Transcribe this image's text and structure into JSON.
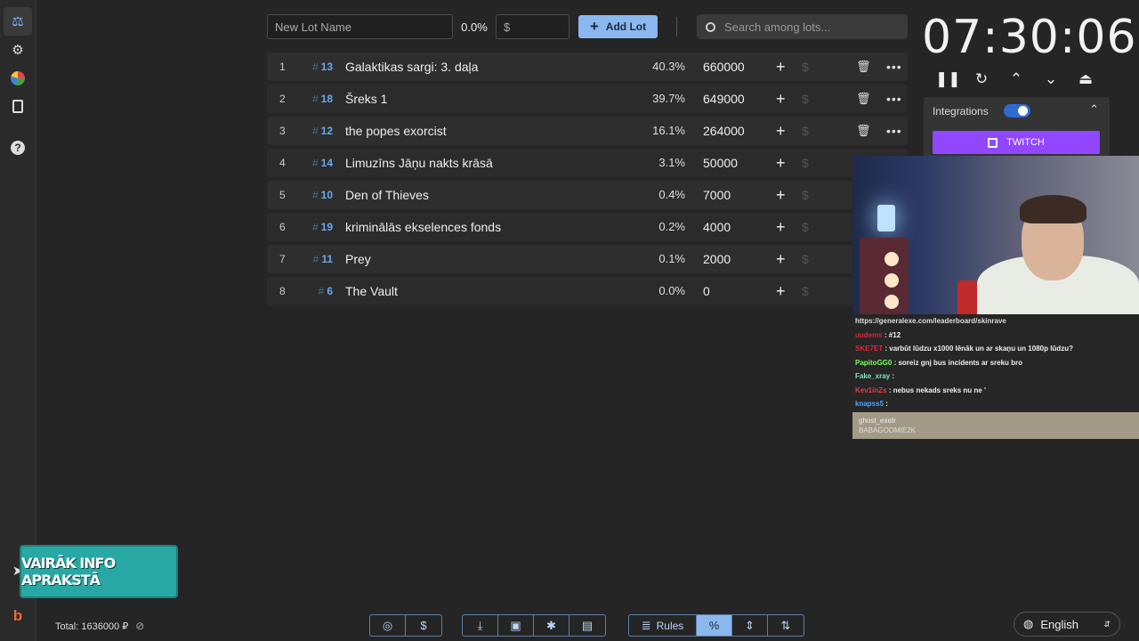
{
  "sidebar": {
    "items": [
      {
        "name": "auction-icon",
        "glyph": "⚖"
      },
      {
        "name": "settings-icon",
        "glyph": "⚙"
      },
      {
        "name": "wheel-icon",
        "glyph": "◕"
      },
      {
        "name": "clipboard-icon",
        "glyph": "📋"
      },
      {
        "name": "help-icon",
        "glyph": "?"
      }
    ],
    "bottom": [
      {
        "name": "telegram-icon",
        "glyph": "➤"
      },
      {
        "name": "boosty-icon",
        "glyph": "b"
      }
    ]
  },
  "topbar": {
    "new_lot_placeholder": "New Lot Name",
    "percent": "0.0%",
    "amount_placeholder": "$",
    "add_lot_label": "Add Lot",
    "search_placeholder": "Search among lots..."
  },
  "lots": [
    {
      "index": "1",
      "id": "13",
      "name": "Galaktikas sargi: 3. daļa",
      "percent": "40.3%",
      "amount": "660000",
      "has_actions": true
    },
    {
      "index": "2",
      "id": "18",
      "name": "Šreks 1",
      "percent": "39.7%",
      "amount": "649000",
      "has_actions": true
    },
    {
      "index": "3",
      "id": "12",
      "name": "the popes exorcist",
      "percent": "16.1%",
      "amount": "264000",
      "has_actions": true
    },
    {
      "index": "4",
      "id": "14",
      "name": "Limuzīns Jāņu nakts krāsā",
      "percent": "3.1%",
      "amount": "50000",
      "has_actions": false
    },
    {
      "index": "5",
      "id": "10",
      "name": "Den of Thieves",
      "percent": "0.4%",
      "amount": "7000",
      "has_actions": false
    },
    {
      "index": "6",
      "id": "19",
      "name": "kriminālās ekselences fonds",
      "percent": "0.2%",
      "amount": "4000",
      "has_actions": false
    },
    {
      "index": "7",
      "id": "11",
      "name": "Prey",
      "percent": "0.1%",
      "amount": "2000",
      "has_actions": false
    },
    {
      "index": "8",
      "id": "6",
      "name": "The Vault",
      "percent": "0.0%",
      "amount": "0",
      "has_actions": false
    }
  ],
  "timer": {
    "value": "07:30:06"
  },
  "integrations": {
    "label": "Integrations",
    "enabled": true,
    "twitch_label": "TWITCH"
  },
  "chat": {
    "url": "https://generalexe.com/leaderboard/skinrave",
    "messages": [
      {
        "user": "uudems",
        "color": "#d8283c",
        "text": ": #12"
      },
      {
        "user": "SKE7ET",
        "color": "#d8283c",
        "text": ": varbūt lūdzu x1000 lēnāk un ar skaņu un 1080p lūdzu?"
      },
      {
        "user": "PapitoGG0",
        "color": "#7cff5a",
        "text": ": soreiz gnj bus incidents ar sreku bro"
      },
      {
        "user": "Fake_xray",
        "color": "#7fe6c8",
        "text": ":"
      },
      {
        "user": "Kev1inZs",
        "color": "#e33a4e",
        "text": ": nebus nekads sreks nu ne '"
      },
      {
        "user": "knapss5",
        "color": "#4ea4ff",
        "text": ":"
      }
    ],
    "footer_user": "ghost_exetr",
    "footer_text": "BABAGOOMIE2K"
  },
  "promo": {
    "text": "VAIRĀK INFO APRAKSTĀ"
  },
  "footer": {
    "total": "Total: 1636000 ₽",
    "rules_label": "Rules",
    "language": "English"
  },
  "colors": {
    "accent": "#8ab8ef",
    "twitch": "#9147ff",
    "id": "#6aa6ef"
  }
}
